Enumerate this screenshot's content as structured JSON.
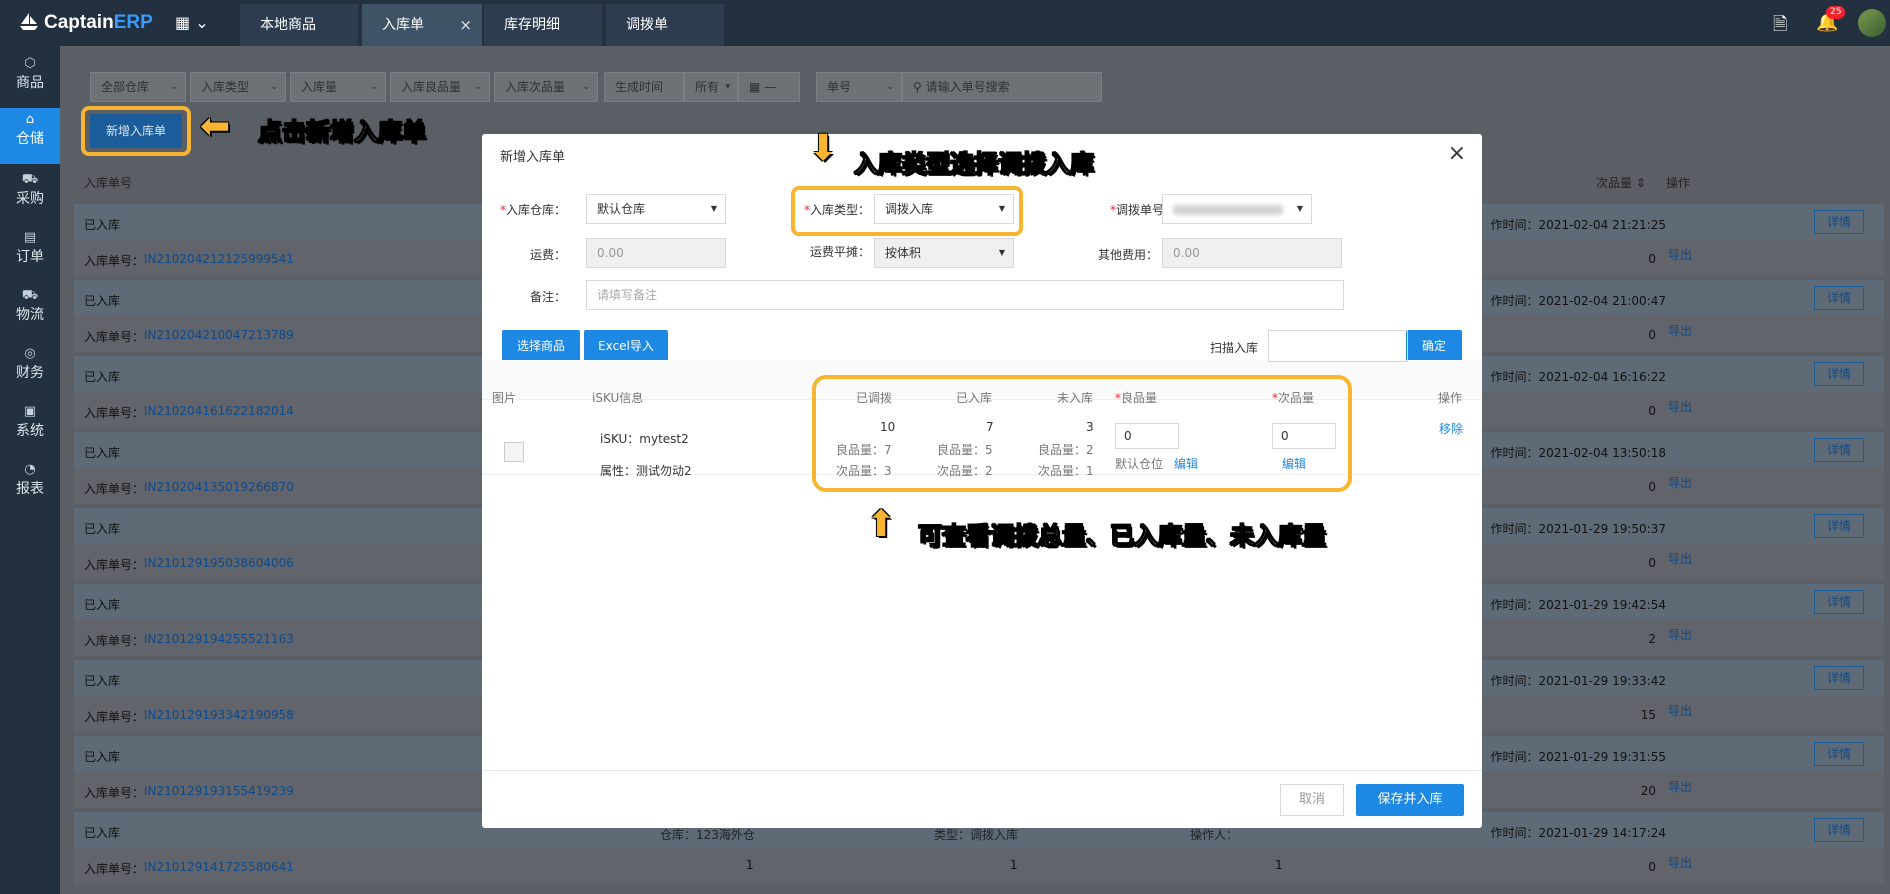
{
  "header": {
    "logo_captain": "Captain",
    "logo_erp": "ERP",
    "tabs": [
      {
        "label": "本地商品"
      },
      {
        "label": "入库单"
      },
      {
        "label": "库存明细"
      },
      {
        "label": "调拨单"
      }
    ],
    "tab_close": "×",
    "notification_count": "25"
  },
  "sidebar": {
    "items": [
      {
        "label": "商品",
        "icon": "cube-icon"
      },
      {
        "label": "仓储",
        "icon": "warehouse-icon"
      },
      {
        "label": "采购",
        "icon": "cart-icon"
      },
      {
        "label": "订单",
        "icon": "order-icon"
      },
      {
        "label": "物流",
        "icon": "truck-icon"
      },
      {
        "label": "财务",
        "icon": "finance-icon"
      },
      {
        "label": "系统",
        "icon": "system-icon"
      },
      {
        "label": "报表",
        "icon": "report-icon"
      }
    ]
  },
  "filters": {
    "warehouse": "全部仓库",
    "type": "入库类型",
    "qty": "入库量",
    "good_qty": "入库良品量",
    "defect_qty": "入库次品量",
    "time": "生成时间",
    "all": "所有",
    "dash": "—",
    "order_no": "单号",
    "search_placeholder": "请输入单号搜索"
  },
  "new_button": "新增入库单",
  "callouts": {
    "click_new": "点击新增入库单",
    "choose_type": "入库类型选择调拨入库",
    "view_qty": "可查看调拨总量、已入库量、未入库量"
  },
  "list": {
    "header_no": "入库单号",
    "header_defect": "次品量",
    "header_action": "操作",
    "status": "已入库",
    "no_prefix": "入库单号：",
    "time_prefix": "作时间：",
    "detail": "详情",
    "export": "导出",
    "rows": [
      {
        "no": "IN210204212125999541",
        "time": "2021-02-04 21:21:25",
        "defect": "0"
      },
      {
        "no": "IN210204210047213789",
        "time": "2021-02-04 21:00:47",
        "defect": "0"
      },
      {
        "no": "IN210204161622182014",
        "time": "2021-02-04 16:16:22",
        "defect": "0"
      },
      {
        "no": "IN210204135019266870",
        "time": "2021-02-04 13:50:18",
        "defect": "0"
      },
      {
        "no": "IN210129195038604006",
        "time": "2021-01-29 19:50:37",
        "defect": "0"
      },
      {
        "no": "IN210129194255521163",
        "time": "2021-01-29 19:42:54",
        "defect": "2"
      },
      {
        "no": "IN210129193342190958",
        "time": "2021-01-29 19:33:42",
        "defect": "15"
      },
      {
        "no": "IN210129193155419239",
        "time": "2021-01-29 19:31:55",
        "defect": "20"
      },
      {
        "no": "IN210129141725580641",
        "time": "2021-01-29 14:17:24",
        "defect": "0"
      }
    ],
    "last_row": {
      "warehouse": "仓库：123海外仓",
      "type": "类型：调拨入库",
      "operator": "操作人：",
      "op_time": "操作时间：2021-01-29 14:17:24",
      "v1": "1",
      "v2": "1",
      "v3": "1"
    }
  },
  "modal": {
    "title": "新增入库单",
    "close": "×",
    "warehouse_label": "入库仓库：",
    "warehouse_value": "默认仓库",
    "type_label": "入库类型：",
    "type_value": "调拨入库",
    "transfer_label": "调拨单号",
    "freight_label": "运费：",
    "freight_value": "0.00",
    "alloc_label": "运费平摊：",
    "alloc_value": "按体积",
    "other_label": "其他费用：",
    "other_value": "0.00",
    "remark_label": "备注：",
    "remark_placeholder": "请填写备注",
    "select_goods": "选择商品",
    "excel_import": "Excel导入",
    "scan_label": "扫描入库",
    "confirm": "确定",
    "table": {
      "headers": [
        "图片",
        "iSKU信息",
        "已调拨",
        "已入库",
        "未入库",
        "良品量",
        "次品量",
        "操作"
      ],
      "row": {
        "isku": "iSKU：mytest2",
        "attr": "属性：测试勿动2",
        "transferred": "10",
        "transferred_good": "良品量：7",
        "transferred_defect": "次品量：3",
        "stocked": "7",
        "stocked_good": "良品量：5",
        "stocked_defect": "次品量：2",
        "pending": "3",
        "pending_good": "良品量：2",
        "pending_defect": "次品量：1",
        "good_input": "0",
        "default_loc": "默认仓位",
        "edit": "编辑",
        "defect_input": "0",
        "remove": "移除"
      }
    },
    "cancel": "取消",
    "save": "保存并入库"
  }
}
